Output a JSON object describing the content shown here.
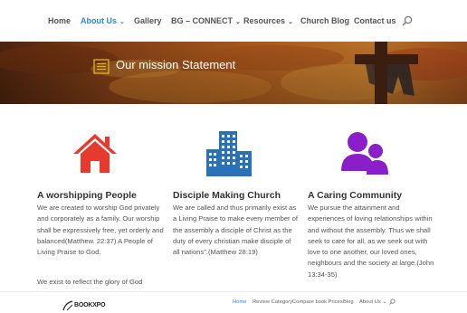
{
  "nav": {
    "items": [
      {
        "label": "Home",
        "has_dropdown": false,
        "active": false
      },
      {
        "label": "About Us",
        "has_dropdown": true,
        "active": true
      },
      {
        "label": "Gallery",
        "has_dropdown": false,
        "active": false
      },
      {
        "label": "BG – CONNECT",
        "has_dropdown": true,
        "active": false
      },
      {
        "label": "Resources",
        "has_dropdown": true,
        "active": false
      },
      {
        "label": "Church Blog",
        "has_dropdown": false,
        "active": false
      },
      {
        "label": "Contact us",
        "has_dropdown": false,
        "active": false
      }
    ],
    "chevron": "⌄",
    "search_icon": "search-icon",
    "active_color": "#2b87da"
  },
  "hero": {
    "title": "Our mission Statement",
    "icon": "list-icon",
    "icon_color": "#e2b21b"
  },
  "features": [
    {
      "icon": "house-icon",
      "icon_color": "#e63a2f",
      "title": "A worshipping People",
      "text": "We are created to worship God privately and corporately as a family. Our worship shall be expressively free, yet orderly and balanced(Matthew. 22:37) A People of Living Praise to God.",
      "extra": "We exist to reflect the glory of God"
    },
    {
      "icon": "buildings-icon",
      "icon_color": "#2a72b8",
      "title": "Disciple Making Church",
      "text": "We are called and thus primarily exist as a Living Praise to make every member of the assembly a disciple of Christ as the duty of every christian make disciple of all nations\".(Matthew 28:19)"
    },
    {
      "icon": "people-icon",
      "icon_color": "#8a1fc9",
      "title": "A Caring Community",
      "text": "We pursue the attainment and experiences of loving relationships within and without the assembly. Thus we shall seek to care for all, as we seek out with love to one another, our loved ones, neighbours and the society at large.(John 13:34-35)"
    }
  ],
  "bottombar": {
    "logo_text": "BOOKXPO",
    "items": [
      {
        "label": "Home",
        "active": true
      },
      {
        "label": "Review Category",
        "active": false
      },
      {
        "label": "Compare book Prices",
        "active": false
      },
      {
        "label": "Blog",
        "active": false
      },
      {
        "label": "About Us ⌄",
        "active": false
      }
    ],
    "search_icon": "search-icon"
  }
}
